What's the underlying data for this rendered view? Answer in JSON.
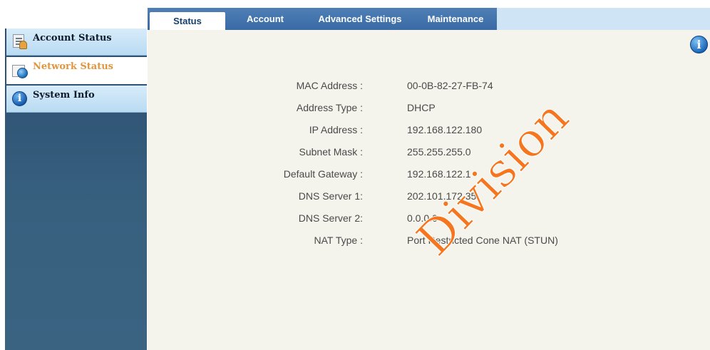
{
  "tabs": [
    "Status",
    "Account",
    "Advanced Settings",
    "Maintenance"
  ],
  "sidebar": {
    "items": [
      {
        "label": "Account Status",
        "icon": "account-status-icon"
      },
      {
        "label": "Network Status",
        "icon": "network-status-icon"
      },
      {
        "label": "System Info",
        "icon": "info-icon"
      }
    ]
  },
  "network": {
    "rows": [
      {
        "key": "MAC Address :",
        "value": "00-0B-82-27-FB-74"
      },
      {
        "key": "Address Type :",
        "value": "DHCP"
      },
      {
        "key": "IP Address :",
        "value": "192.168.122.180"
      },
      {
        "key": "Subnet Mask :",
        "value": "255.255.255.0"
      },
      {
        "key": "Default Gateway :",
        "value": "192.168.122.1"
      },
      {
        "key": "DNS Server 1:",
        "value": "202.101.172.35"
      },
      {
        "key": "DNS Server 2:",
        "value": "0.0.0.0"
      },
      {
        "key": "NAT Type :",
        "value": "Port Restricted Cone NAT (STUN)"
      }
    ]
  },
  "help_icon": "i",
  "watermark": "Division",
  "colors": {
    "tab_bar": "#3a6aa4",
    "sidebar": "#2c4d70",
    "active_item": "#e0963f",
    "watermark": "#f5761f"
  }
}
